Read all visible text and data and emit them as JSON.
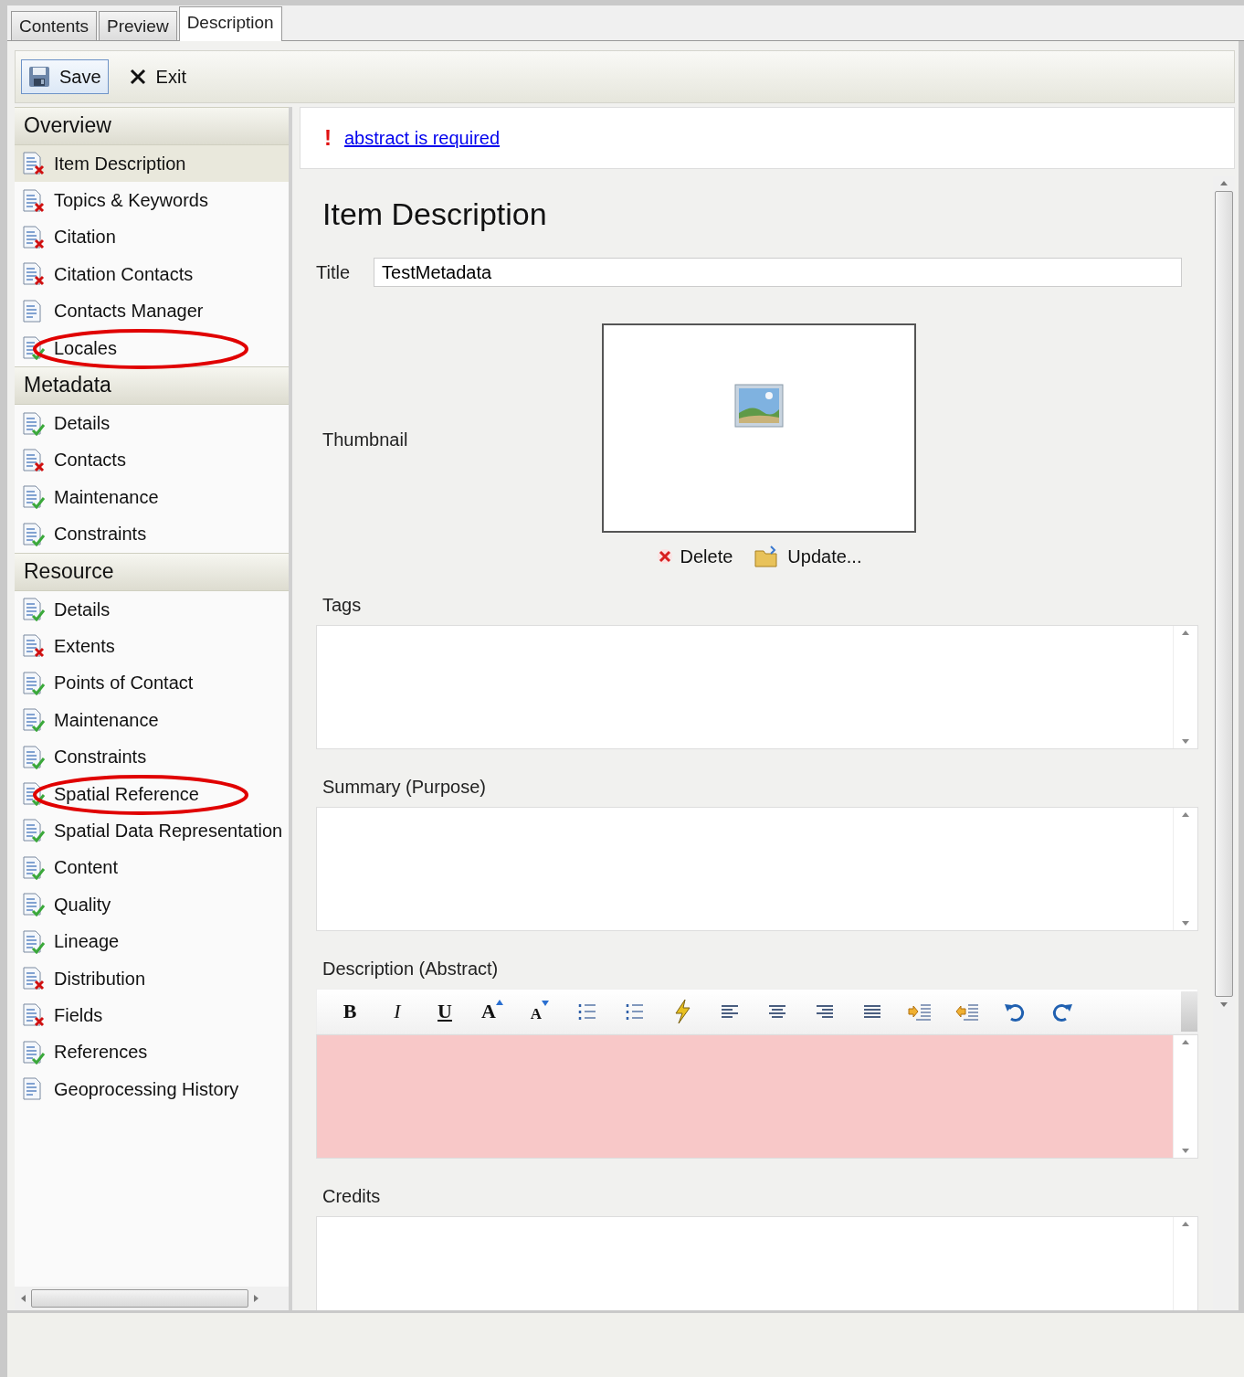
{
  "tabs": [
    {
      "label": "Contents",
      "selected": false
    },
    {
      "label": "Preview",
      "selected": false
    },
    {
      "label": "Description",
      "selected": true
    }
  ],
  "toolbar": [
    {
      "kind": "save",
      "label": "Save",
      "selected": true
    },
    {
      "kind": "exit",
      "label": "Exit",
      "selected": false
    }
  ],
  "sidebar": {
    "groups": [
      {
        "title": "Overview",
        "items": [
          {
            "label": "Item Description",
            "kind": "error",
            "selected": true,
            "circled": false
          },
          {
            "label": "Topics & Keywords",
            "kind": "error",
            "selected": false,
            "circled": false
          },
          {
            "label": "Citation",
            "kind": "error",
            "selected": false,
            "circled": false
          },
          {
            "label": "Citation Contacts",
            "kind": "error",
            "selected": false,
            "circled": false
          },
          {
            "label": "Contacts Manager",
            "kind": "plain",
            "selected": false,
            "circled": false
          },
          {
            "label": "Locales",
            "kind": "valid",
            "selected": false,
            "circled": true
          }
        ]
      },
      {
        "title": "Metadata",
        "items": [
          {
            "label": "Details",
            "kind": "valid",
            "selected": false,
            "circled": false
          },
          {
            "label": "Contacts",
            "kind": "error",
            "selected": false,
            "circled": false
          },
          {
            "label": "Maintenance",
            "kind": "valid",
            "selected": false,
            "circled": false
          },
          {
            "label": "Constraints",
            "kind": "valid",
            "selected": false,
            "circled": false
          }
        ]
      },
      {
        "title": "Resource",
        "items": [
          {
            "label": "Details",
            "kind": "valid",
            "selected": false,
            "circled": false
          },
          {
            "label": "Extents",
            "kind": "error",
            "selected": false,
            "circled": false
          },
          {
            "label": "Points of Contact",
            "kind": "valid",
            "selected": false,
            "circled": false
          },
          {
            "label": "Maintenance",
            "kind": "valid",
            "selected": false,
            "circled": false
          },
          {
            "label": "Constraints",
            "kind": "valid",
            "selected": false,
            "circled": false
          },
          {
            "label": "Spatial Reference",
            "kind": "valid",
            "selected": false,
            "circled": true
          },
          {
            "label": "Spatial Data Representation",
            "kind": "valid",
            "selected": false,
            "circled": false
          },
          {
            "label": "Content",
            "kind": "valid",
            "selected": false,
            "circled": false
          },
          {
            "label": "Quality",
            "kind": "valid",
            "selected": false,
            "circled": false
          },
          {
            "label": "Lineage",
            "kind": "valid",
            "selected": false,
            "circled": false
          },
          {
            "label": "Distribution",
            "kind": "error",
            "selected": false,
            "circled": false
          },
          {
            "label": "Fields",
            "kind": "error",
            "selected": false,
            "circled": false
          },
          {
            "label": "References",
            "kind": "valid",
            "selected": false,
            "circled": false
          },
          {
            "label": "Geoprocessing History",
            "kind": "plain",
            "selected": false,
            "circled": false
          }
        ]
      }
    ]
  },
  "error_banner": {
    "icon": "!",
    "message": "abstract is required"
  },
  "form": {
    "heading": "Item Description",
    "title": {
      "label": "Title",
      "value": "TestMetadata"
    },
    "thumbnail": {
      "label": "Thumbnail",
      "actions": [
        {
          "kind": "delete",
          "label": "Delete"
        },
        {
          "kind": "update",
          "label": "Update..."
        }
      ]
    },
    "text_areas": [
      {
        "label": "Tags",
        "invalid": false,
        "rich_toolbar": false
      },
      {
        "label": "Summary (Purpose)",
        "invalid": false,
        "rich_toolbar": false
      },
      {
        "label": "Description (Abstract)",
        "invalid": true,
        "rich_toolbar": true
      },
      {
        "label": "Credits",
        "invalid": false,
        "rich_toolbar": false
      }
    ]
  },
  "editor_toolbar": [
    {
      "kind": "bold",
      "label": "B"
    },
    {
      "kind": "italic",
      "label": "I"
    },
    {
      "kind": "underline",
      "label": "U"
    },
    {
      "kind": "grow",
      "label": "A"
    },
    {
      "kind": "shrink",
      "label": "A"
    },
    {
      "kind": "bullets"
    },
    {
      "kind": "numbers"
    },
    {
      "kind": "clear"
    },
    {
      "kind": "left"
    },
    {
      "kind": "center"
    },
    {
      "kind": "right"
    },
    {
      "kind": "justify"
    },
    {
      "kind": "indent"
    },
    {
      "kind": "outdent"
    },
    {
      "kind": "undo"
    },
    {
      "kind": "redo"
    }
  ]
}
